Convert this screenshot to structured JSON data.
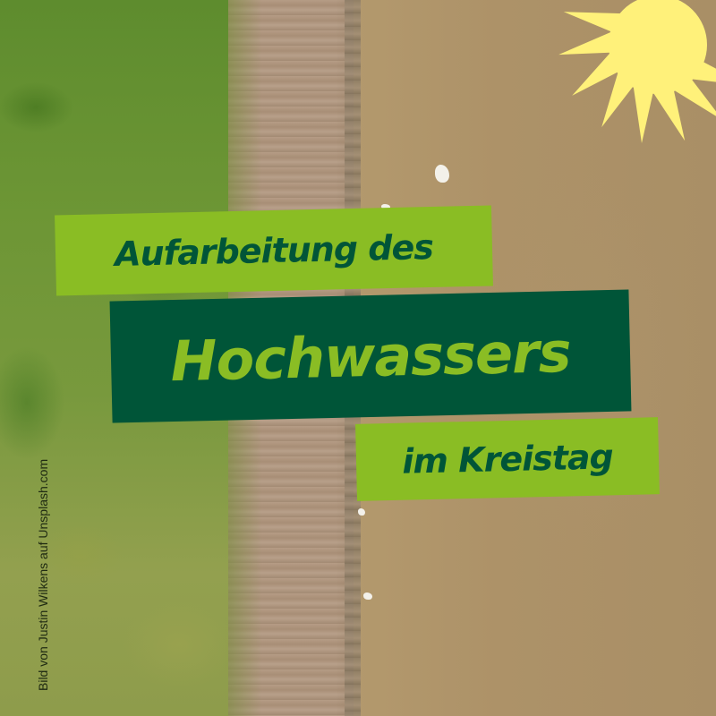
{
  "title": {
    "line1": "Aufarbeitung des",
    "line2": "Hochwassers",
    "line3": "im Kreistag"
  },
  "credit": "Bild von Justin Wilkens auf Unsplash.com",
  "colors": {
    "light_green": "#8abd24",
    "dark_green": "#005538",
    "flower_yellow": "#fff17a"
  },
  "logo_icon": "sunflower-icon"
}
